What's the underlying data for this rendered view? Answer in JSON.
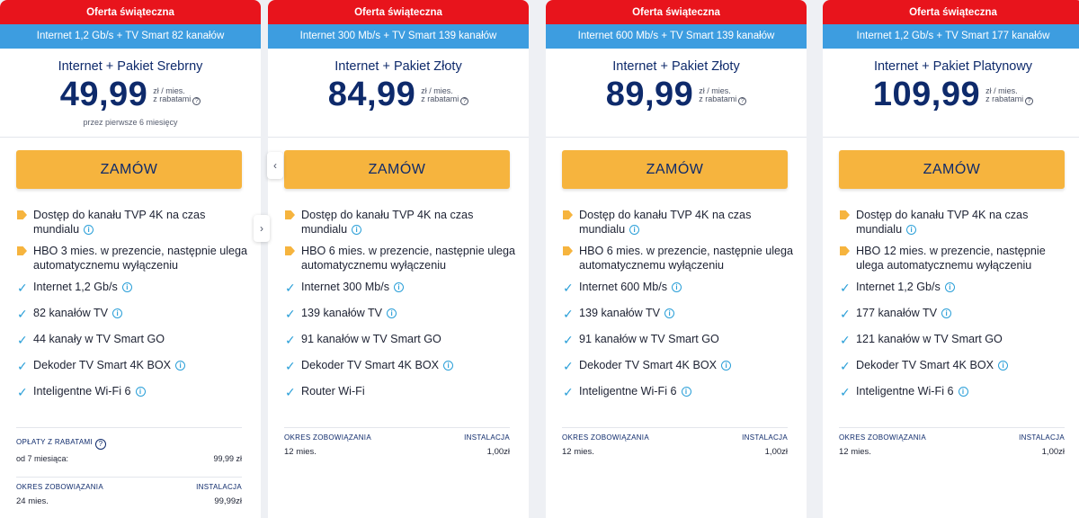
{
  "cards": [
    {
      "promo": "Oferta świąteczna",
      "bundle": "Internet 1,2 Gb/s + TV Smart 82 kanałów",
      "name": "Internet + Pakiet Srebrny",
      "price": "49,99",
      "unit_line1": "zł / mies.",
      "unit_line2": "z rabatami",
      "note": "przez pierwsze 6 miesięcy",
      "order": "ZAMÓW",
      "features": [
        {
          "text": "Dostęp do kanału TVP 4K na czas mundialu",
          "icon": "tag-icon",
          "info": true
        },
        {
          "text": "HBO 3 mies. w prezencie, następnie ulega automatycznemu wyłączeniu",
          "icon": "tag-icon",
          "info": false
        },
        {
          "text": "Internet 1,2 Gb/s",
          "icon": "check-icon",
          "info": true
        },
        {
          "text": "82 kanałów TV",
          "icon": "check-icon",
          "info": true
        },
        {
          "text": "44 kanały w TV Smart GO",
          "icon": "check-icon",
          "info": false
        },
        {
          "text": "Dekoder TV Smart 4K BOX",
          "icon": "check-icon",
          "info": true
        },
        {
          "text": "Inteligentne Wi-Fi 6",
          "icon": "check-icon",
          "info": true
        }
      ],
      "fees": {
        "head": "OPŁATY Z RABATAMI",
        "label": "od 7 miesiąca:",
        "value": "99,99 zł"
      },
      "term_label": "OKRES ZOBOWIĄZANIA",
      "term_value": "24 mies.",
      "install_label": "INSTALACJA",
      "install_value": "99,99zł"
    },
    {
      "promo": "Oferta świąteczna",
      "bundle": "Internet 300 Mb/s + TV Smart 139 kanałów",
      "name": "Internet + Pakiet Złoty",
      "price": "84,99",
      "unit_line1": "zł / mies.",
      "unit_line2": "z rabatami",
      "note": "",
      "order": "ZAMÓW",
      "features": [
        {
          "text": "Dostęp do kanału TVP 4K na czas mundialu",
          "icon": "tag-icon",
          "info": true
        },
        {
          "text": "HBO 6 mies. w prezencie, następnie ulega automatycznemu wyłączeniu",
          "icon": "tag-icon",
          "info": false
        },
        {
          "text": "Internet 300 Mb/s",
          "icon": "check-icon",
          "info": true
        },
        {
          "text": "139 kanałów TV",
          "icon": "check-icon",
          "info": true
        },
        {
          "text": "91 kanałów w TV Smart GO",
          "icon": "check-icon",
          "info": false
        },
        {
          "text": "Dekoder TV Smart 4K BOX",
          "icon": "check-icon",
          "info": true
        },
        {
          "text": "Router Wi-Fi",
          "icon": "check-icon",
          "info": false
        }
      ],
      "term_label": "OKRES ZOBOWIĄZANIA",
      "term_value": "12 mies.",
      "install_label": "INSTALACJA",
      "install_value": "1,00zł"
    },
    {
      "promo": "Oferta świąteczna",
      "bundle": "Internet 600 Mb/s + TV Smart 139 kanałów",
      "name": "Internet + Pakiet Złoty",
      "price": "89,99",
      "unit_line1": "zł / mies.",
      "unit_line2": "z rabatami",
      "note": "",
      "order": "ZAMÓW",
      "features": [
        {
          "text": "Dostęp do kanału TVP 4K na czas mundialu",
          "icon": "tag-icon",
          "info": true
        },
        {
          "text": "HBO 6 mies. w prezencie, następnie ulega automatycznemu wyłączeniu",
          "icon": "tag-icon",
          "info": false
        },
        {
          "text": "Internet 600 Mb/s",
          "icon": "check-icon",
          "info": true
        },
        {
          "text": "139 kanałów TV",
          "icon": "check-icon",
          "info": true
        },
        {
          "text": "91 kanałów w TV Smart GO",
          "icon": "check-icon",
          "info": false
        },
        {
          "text": "Dekoder TV Smart 4K BOX",
          "icon": "check-icon",
          "info": true
        },
        {
          "text": "Inteligentne Wi-Fi 6",
          "icon": "check-icon",
          "info": true
        }
      ],
      "term_label": "OKRES ZOBOWIĄZANIA",
      "term_value": "12 mies.",
      "install_label": "INSTALACJA",
      "install_value": "1,00zł"
    },
    {
      "promo": "Oferta świąteczna",
      "bundle": "Internet 1,2 Gb/s + TV Smart 177 kanałów",
      "name": "Internet + Pakiet Platynowy",
      "price": "109,99",
      "unit_line1": "zł / mies.",
      "unit_line2": "z rabatami",
      "note": "",
      "order": "ZAMÓW",
      "features": [
        {
          "text": "Dostęp do kanału TVP 4K na czas mundialu",
          "icon": "tag-icon",
          "info": true
        },
        {
          "text": "HBO 12 mies. w prezencie, następnie ulega automatycznemu wyłączeniu",
          "icon": "tag-icon",
          "info": false
        },
        {
          "text": "Internet 1,2 Gb/s",
          "icon": "check-icon",
          "info": true
        },
        {
          "text": "177 kanałów TV",
          "icon": "check-icon",
          "info": true
        },
        {
          "text": "121 kanałów w TV Smart GO",
          "icon": "check-icon",
          "info": false
        },
        {
          "text": "Dekoder TV Smart 4K BOX",
          "icon": "check-icon",
          "info": true
        },
        {
          "text": "Inteligentne Wi-Fi 6",
          "icon": "check-icon",
          "info": true
        }
      ],
      "term_label": "OKRES ZOBOWIĄZANIA",
      "term_value": "12 mies.",
      "install_label": "INSTALACJA",
      "install_value": "1,00zł"
    }
  ],
  "nav": {
    "prev_icon": "chevron-left-icon",
    "prev_glyph": "‹",
    "next_icon": "chevron-right-icon",
    "next_glyph": "›"
  },
  "colors": {
    "promo": "#e8141c",
    "bundle": "#3d9de0",
    "order": "#f6b43e",
    "title": "#0e2a6b",
    "check": "#2a9fd8"
  }
}
